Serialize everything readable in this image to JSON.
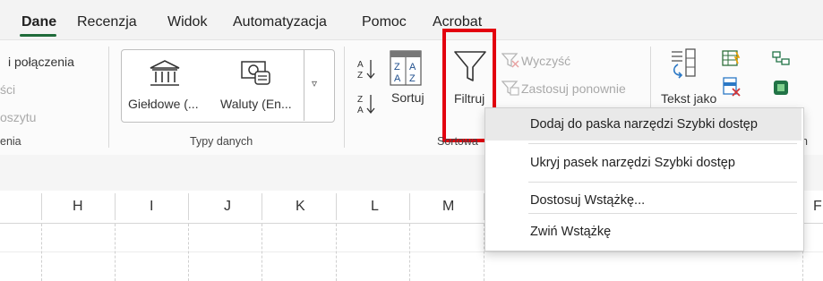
{
  "tabs": [
    {
      "label": "Dane",
      "active": true
    },
    {
      "label": "Recenzja"
    },
    {
      "label": "Widok"
    },
    {
      "label": "Automatyzacja"
    },
    {
      "label": "Pomoc"
    },
    {
      "label": "Acrobat"
    }
  ],
  "connections": {
    "line1": "i połączenia",
    "line2": "ści",
    "line3": "oszytu",
    "group_label": "enia"
  },
  "data_types": {
    "stocks_label": "Giełdowe (...",
    "currency_label": "Waluty (En...",
    "group_label": "Typy danych"
  },
  "sort_filter": {
    "sort_label": "Sortuj",
    "filter_label": "Filtruj",
    "clear_label": "Wyczyść",
    "reapply_label": "Zastosuj ponownie",
    "group_label": "Sortowa"
  },
  "data_tools": {
    "text_to_columns_label": "Tekst jako",
    "group_label": "h"
  },
  "columns": [
    "H",
    "I",
    "J",
    "K",
    "L",
    "M",
    "F"
  ],
  "context_menu": {
    "items": [
      {
        "label": "Dodaj do paska narzędzi Szybki dostęp",
        "highlighted": true
      },
      {
        "label": "Ukryj pasek narzędzi Szybki dostęp"
      },
      {
        "label": "Dostosuj Wstążkę..."
      },
      {
        "label": "Zwiń Wstążkę"
      }
    ]
  },
  "colors": {
    "accent": "#1f6b3a",
    "highlight_box": "#e3000f",
    "excel_green": "#217346"
  }
}
